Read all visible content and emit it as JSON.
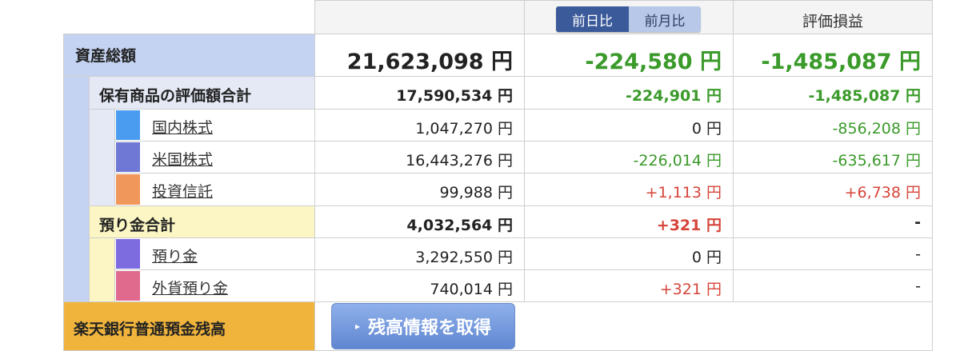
{
  "header": {
    "toggle_day": "前日比",
    "toggle_month": "前月比",
    "pl_header": "評価損益"
  },
  "total": {
    "label": "資産総額",
    "value": "21,623,098 円",
    "day_change": "-224,580 円",
    "pl": "-1,485,087 円"
  },
  "holdings": {
    "label": "保有商品の評価額合計",
    "value": "17,590,534 円",
    "day_change": "-224,901 円",
    "pl": "-1,485,087 円"
  },
  "rows": [
    {
      "label": "国内株式",
      "value": "1,047,270 円",
      "day_change": "0 円",
      "pl": "-856,208 円",
      "color": "#4a9cf0"
    },
    {
      "label": "米国株式",
      "value": "16,443,276 円",
      "day_change": "-226,014 円",
      "pl": "-635,617 円",
      "color": "#6f78d4"
    },
    {
      "label": "投資信託",
      "value": "99,988 円",
      "day_change": "+1,113 円",
      "pl": "+6,738 円",
      "color": "#f0975b"
    }
  ],
  "deposits": {
    "label": "預り金合計",
    "value": "4,032,564 円",
    "day_change": "+321 円",
    "pl": "-"
  },
  "deposit_rows": [
    {
      "label": "預り金",
      "value": "3,292,550 円",
      "day_change": "0 円",
      "pl": "-",
      "color": "#7d6be0"
    },
    {
      "label": "外貨預り金",
      "value": "740,014 円",
      "day_change": "+321 円",
      "pl": "-",
      "color": "#e06a8e"
    }
  ],
  "bank": {
    "label": "楽天銀行普通預金残高",
    "button": "残高情報を取得"
  }
}
